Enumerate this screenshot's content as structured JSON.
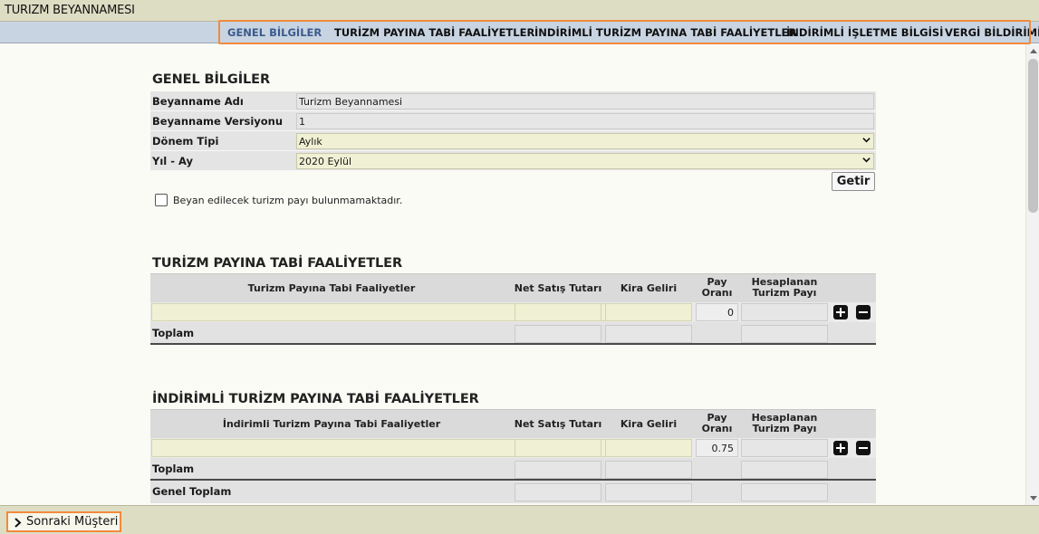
{
  "app": {
    "title": "TURIZM BEYANNAMESI"
  },
  "tabs": [
    {
      "label": "GENEL BİLGİLER",
      "active": true
    },
    {
      "label": "TURİZM PAYINA TABİ FAALİYETLER",
      "active": false
    },
    {
      "label": "İNDİRİMLİ TURİZM PAYINA TABİ FAALİYETLER",
      "active": false
    },
    {
      "label": "İNDİRİMLİ İŞLETME BİLGİSİ",
      "active": false
    },
    {
      "label": "VERGİ BİLDİRİMİ",
      "active": false
    }
  ],
  "genel": {
    "title": "GENEL BİLGİLER",
    "rows": [
      {
        "label": "Beyanname Adı",
        "value": "Turizm Beyannamesi"
      },
      {
        "label": "Beyanname Versiyonu",
        "value": "1"
      },
      {
        "label": "Dönem Tipi",
        "value": "Aylık"
      },
      {
        "label": "Yıl - Ay",
        "value": "2020 Eylül"
      }
    ],
    "getir_label": "Getir",
    "checkbox_label": "Beyan edilecek turizm payı bulunmamaktadır.",
    "checkbox_checked": false
  },
  "turizm": {
    "title": "TURİZM PAYINA TABİ FAALİYETLER",
    "headers": {
      "faaliyet": "Turizm Payına Tabi Faaliyetler",
      "net_satis": "Net Satış Tutarı",
      "kira": "Kira Geliri",
      "pay_line1": "Pay",
      "pay_line2": "Oranı",
      "hesap_line1": "Hesaplanan",
      "hesap_line2": "Turizm Payı"
    },
    "pay_orani": "0",
    "toplam_label": "Toplam"
  },
  "indirimli": {
    "title": "İNDİRİMLİ TURİZM PAYINA TABİ FAALİYETLER",
    "headers": {
      "faaliyet": "İndirimli Turizm Payına Tabi Faaliyetler",
      "net_satis": "Net Satış Tutarı",
      "kira": "Kira Geliri",
      "pay_line1": "Pay",
      "pay_line2": "Oranı",
      "hesap_line1": "Hesaplanan",
      "hesap_line2": "Turizm Payı"
    },
    "pay_orani": "0.75",
    "toplam_label": "Toplam",
    "genel_toplam_label": "Genel Toplam"
  },
  "footer": {
    "next_label": "Sonraki Müşteri"
  },
  "colors": {
    "highlight": "#f28a3c",
    "active_tab": "#3b5b8c",
    "tab_bar": "#c9d4e2",
    "input_yellow": "#f0f0d4"
  }
}
